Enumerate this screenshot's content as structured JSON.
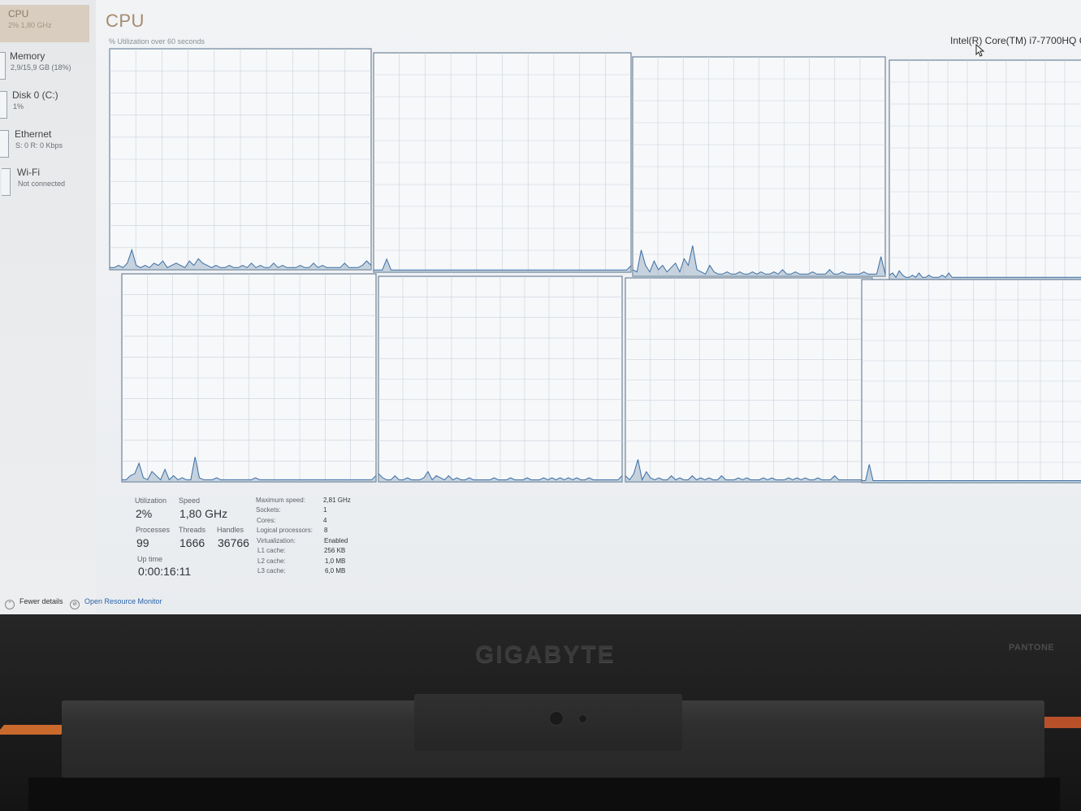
{
  "sidebar": {
    "items": [
      {
        "name": "CPU",
        "sub": "2% 1,80 GHz"
      },
      {
        "name": "Memory",
        "sub": "2,9/15,9 GB (18%)"
      },
      {
        "name": "Disk 0 (C:)",
        "sub": "1%"
      },
      {
        "name": "Ethernet",
        "sub": "S: 0 R: 0 Kbps"
      },
      {
        "name": "Wi-Fi",
        "sub": "Not connected"
      }
    ]
  },
  "header": {
    "title": "CPU",
    "subtitle": "% Utilization over 60 seconds",
    "cpu_model": "Intel(R) Core(TM) i7-7700HQ C"
  },
  "chart_data": {
    "type": "area",
    "title": "% Utilization over 60 seconds",
    "ylim": [
      0,
      100
    ],
    "grid": true,
    "series": [
      {
        "values": [
          1,
          1,
          2,
          1,
          3,
          9,
          2,
          1,
          2,
          1,
          3,
          2,
          4,
          1,
          2,
          3,
          2,
          1,
          4,
          2,
          5,
          3,
          2,
          1,
          2,
          1,
          1,
          2,
          1,
          1,
          2,
          1,
          3,
          1,
          2,
          1,
          1,
          3,
          1,
          2,
          1,
          1,
          1,
          2,
          1,
          1,
          3,
          1,
          2,
          1,
          1,
          1,
          1,
          3,
          1,
          1,
          1,
          2,
          4,
          2
        ]
      },
      {
        "values": [
          1,
          1,
          1,
          6,
          1,
          1,
          1,
          1,
          1,
          1,
          1,
          1,
          1,
          1,
          1,
          1,
          1,
          1,
          1,
          1,
          1,
          1,
          1,
          1,
          1,
          1,
          1,
          1,
          1,
          1,
          1,
          1,
          1,
          1,
          1,
          1,
          1,
          1,
          1,
          1,
          1,
          1,
          1,
          1,
          1,
          1,
          1,
          1,
          1,
          1,
          1,
          1,
          1,
          1,
          1,
          1,
          1,
          1,
          1,
          3
        ]
      },
      {
        "values": [
          3,
          2,
          12,
          5,
          2,
          7,
          3,
          5,
          2,
          4,
          6,
          2,
          8,
          5,
          14,
          3,
          2,
          1,
          5,
          2,
          1,
          1,
          2,
          1,
          1,
          2,
          1,
          1,
          2,
          1,
          2,
          1,
          1,
          2,
          1,
          3,
          1,
          1,
          2,
          1,
          1,
          1,
          2,
          1,
          1,
          1,
          3,
          1,
          1,
          2,
          1,
          1,
          1,
          1,
          2,
          1,
          1,
          1,
          9,
          1
        ]
      },
      {
        "values": [
          2,
          3,
          1,
          4,
          2,
          1,
          1,
          2,
          1,
          3,
          1,
          1,
          2,
          1,
          1,
          1,
          2,
          1,
          3,
          1,
          1,
          1,
          1,
          1,
          1,
          1,
          1,
          1,
          1,
          1,
          1,
          1,
          1,
          1,
          1,
          1,
          1,
          1,
          1,
          1,
          1,
          1,
          1,
          1,
          1,
          1,
          1,
          1,
          1,
          1,
          1,
          1,
          1,
          1,
          1,
          1,
          1,
          1,
          1,
          1
        ]
      },
      {
        "values": [
          1,
          1,
          3,
          4,
          9,
          2,
          1,
          5,
          3,
          1,
          6,
          1,
          3,
          1,
          2,
          1,
          1,
          12,
          2,
          1,
          1,
          1,
          2,
          1,
          1,
          1,
          1,
          1,
          1,
          1,
          1,
          2,
          1,
          1,
          1,
          1,
          1,
          1,
          1,
          1,
          1,
          1,
          1,
          1,
          1,
          1,
          1,
          1,
          1,
          1,
          1,
          1,
          1,
          1,
          1,
          1,
          1,
          1,
          1,
          3
        ]
      },
      {
        "values": [
          4,
          2,
          1,
          1,
          3,
          1,
          1,
          2,
          1,
          1,
          1,
          2,
          5,
          1,
          3,
          2,
          1,
          3,
          1,
          2,
          1,
          1,
          2,
          1,
          1,
          1,
          1,
          1,
          2,
          1,
          1,
          1,
          2,
          1,
          1,
          1,
          2,
          1,
          1,
          1,
          2,
          1,
          2,
          1,
          2,
          1,
          2,
          1,
          2,
          1,
          1,
          2,
          1,
          1,
          1,
          1,
          1,
          1,
          1,
          3
        ]
      },
      {
        "values": [
          3,
          1,
          4,
          11,
          1,
          5,
          2,
          1,
          2,
          1,
          1,
          3,
          1,
          2,
          1,
          1,
          3,
          1,
          2,
          1,
          2,
          1,
          1,
          3,
          1,
          1,
          1,
          2,
          1,
          2,
          1,
          1,
          1,
          2,
          1,
          2,
          1,
          1,
          1,
          2,
          1,
          2,
          1,
          2,
          1,
          1,
          2,
          1,
          1,
          1,
          3,
          1,
          1,
          1,
          1,
          1,
          1,
          1,
          1,
          1
        ]
      },
      {
        "values": [
          1,
          1,
          9,
          1,
          1,
          1,
          1,
          1,
          1,
          1,
          1,
          1,
          1,
          1,
          1,
          1,
          1,
          1,
          1,
          1,
          1,
          1,
          1,
          1,
          1,
          1,
          1,
          1,
          1,
          1,
          1,
          1,
          1,
          1,
          1,
          1,
          1,
          1,
          1,
          1,
          1,
          1,
          1,
          1,
          1,
          1,
          1,
          1,
          1,
          1,
          1,
          1,
          1,
          1,
          1,
          1,
          1,
          1,
          1,
          1
        ]
      }
    ]
  },
  "stats": {
    "utilization_label": "Utilization",
    "utilization": "2%",
    "speed_label": "Speed",
    "speed": "1,80 GHz",
    "processes_label": "Processes",
    "processes": "99",
    "threads_label": "Threads",
    "threads": "1666",
    "handles_label": "Handles",
    "handles": "36766",
    "uptime_label": "Up time",
    "uptime": "0:00:16:11"
  },
  "specs": [
    {
      "k": "Maximum speed:",
      "v": "2,81 GHz"
    },
    {
      "k": "Sockets:",
      "v": "1"
    },
    {
      "k": "Cores:",
      "v": "4"
    },
    {
      "k": "Logical processors:",
      "v": "8"
    },
    {
      "k": "Virtualization:",
      "v": "Enabled"
    },
    {
      "k": "L1 cache:",
      "v": "256 KB"
    },
    {
      "k": "L2 cache:",
      "v": "1,0 MB"
    },
    {
      "k": "L3 cache:",
      "v": "6,0 MB"
    }
  ],
  "footer": {
    "fewer_details": "Fewer details",
    "open_resource_monitor": "Open Resource Monitor"
  },
  "bezel": {
    "brand": "GIGABYTE",
    "badge": "PANTONE"
  },
  "colors": {
    "graph_line": "#3a6ea5",
    "graph_fill": "#8aa3bb",
    "grid": "#c8d2dc",
    "accent_title": "#a58c6e"
  }
}
